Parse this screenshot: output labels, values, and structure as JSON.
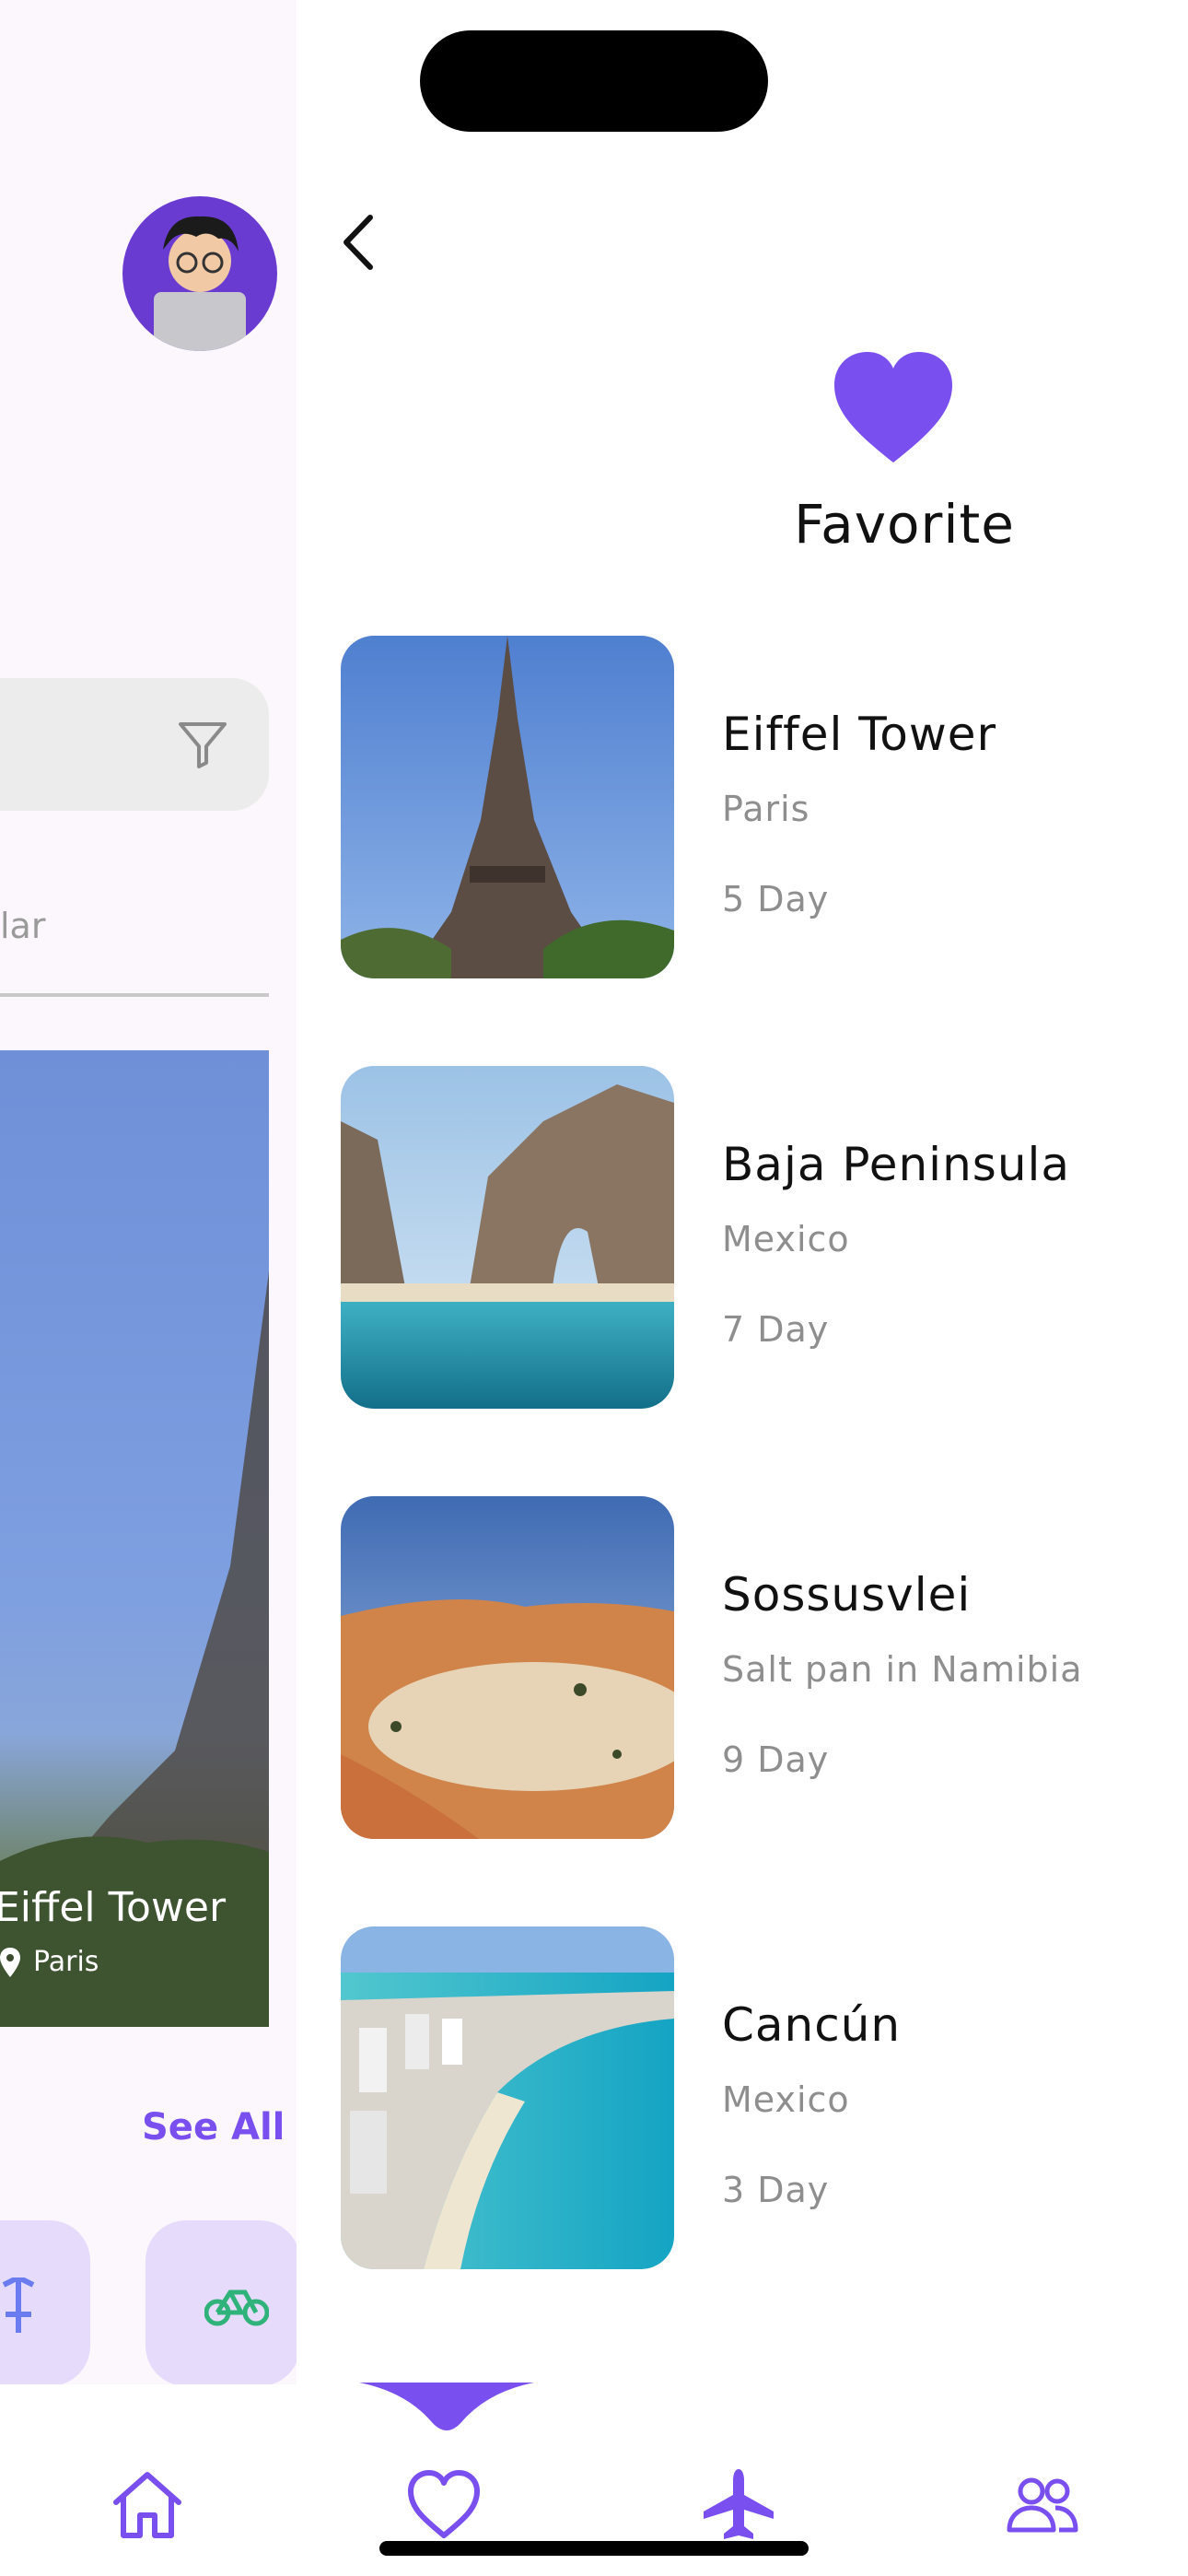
{
  "background_screen": {
    "tab_partial": "lar",
    "featured_place": "Eiffel Tower",
    "featured_location": "Paris",
    "see_all": "See All"
  },
  "header": {
    "title": "Favorite"
  },
  "favorites": [
    {
      "name": "Eiffel Tower",
      "location": "Paris",
      "duration": "5 Day"
    },
    {
      "name": "Baja Peninsula",
      "location": "Mexico",
      "duration": "7 Day"
    },
    {
      "name": "Sossusvlei",
      "location": "Salt pan in Namibia",
      "duration": "9 Day"
    },
    {
      "name": "Cancún",
      "location": "Mexico",
      "duration": "3 Day"
    }
  ],
  "tabs": [
    {
      "icon": "home-icon",
      "selected": false
    },
    {
      "icon": "heart-icon",
      "selected": true
    },
    {
      "icon": "plane-icon",
      "selected": false
    },
    {
      "icon": "people-icon",
      "selected": false
    }
  ],
  "colors": {
    "accent": "#7a4ff0",
    "text_primary": "#111111",
    "text_secondary": "#8e8e8e"
  }
}
